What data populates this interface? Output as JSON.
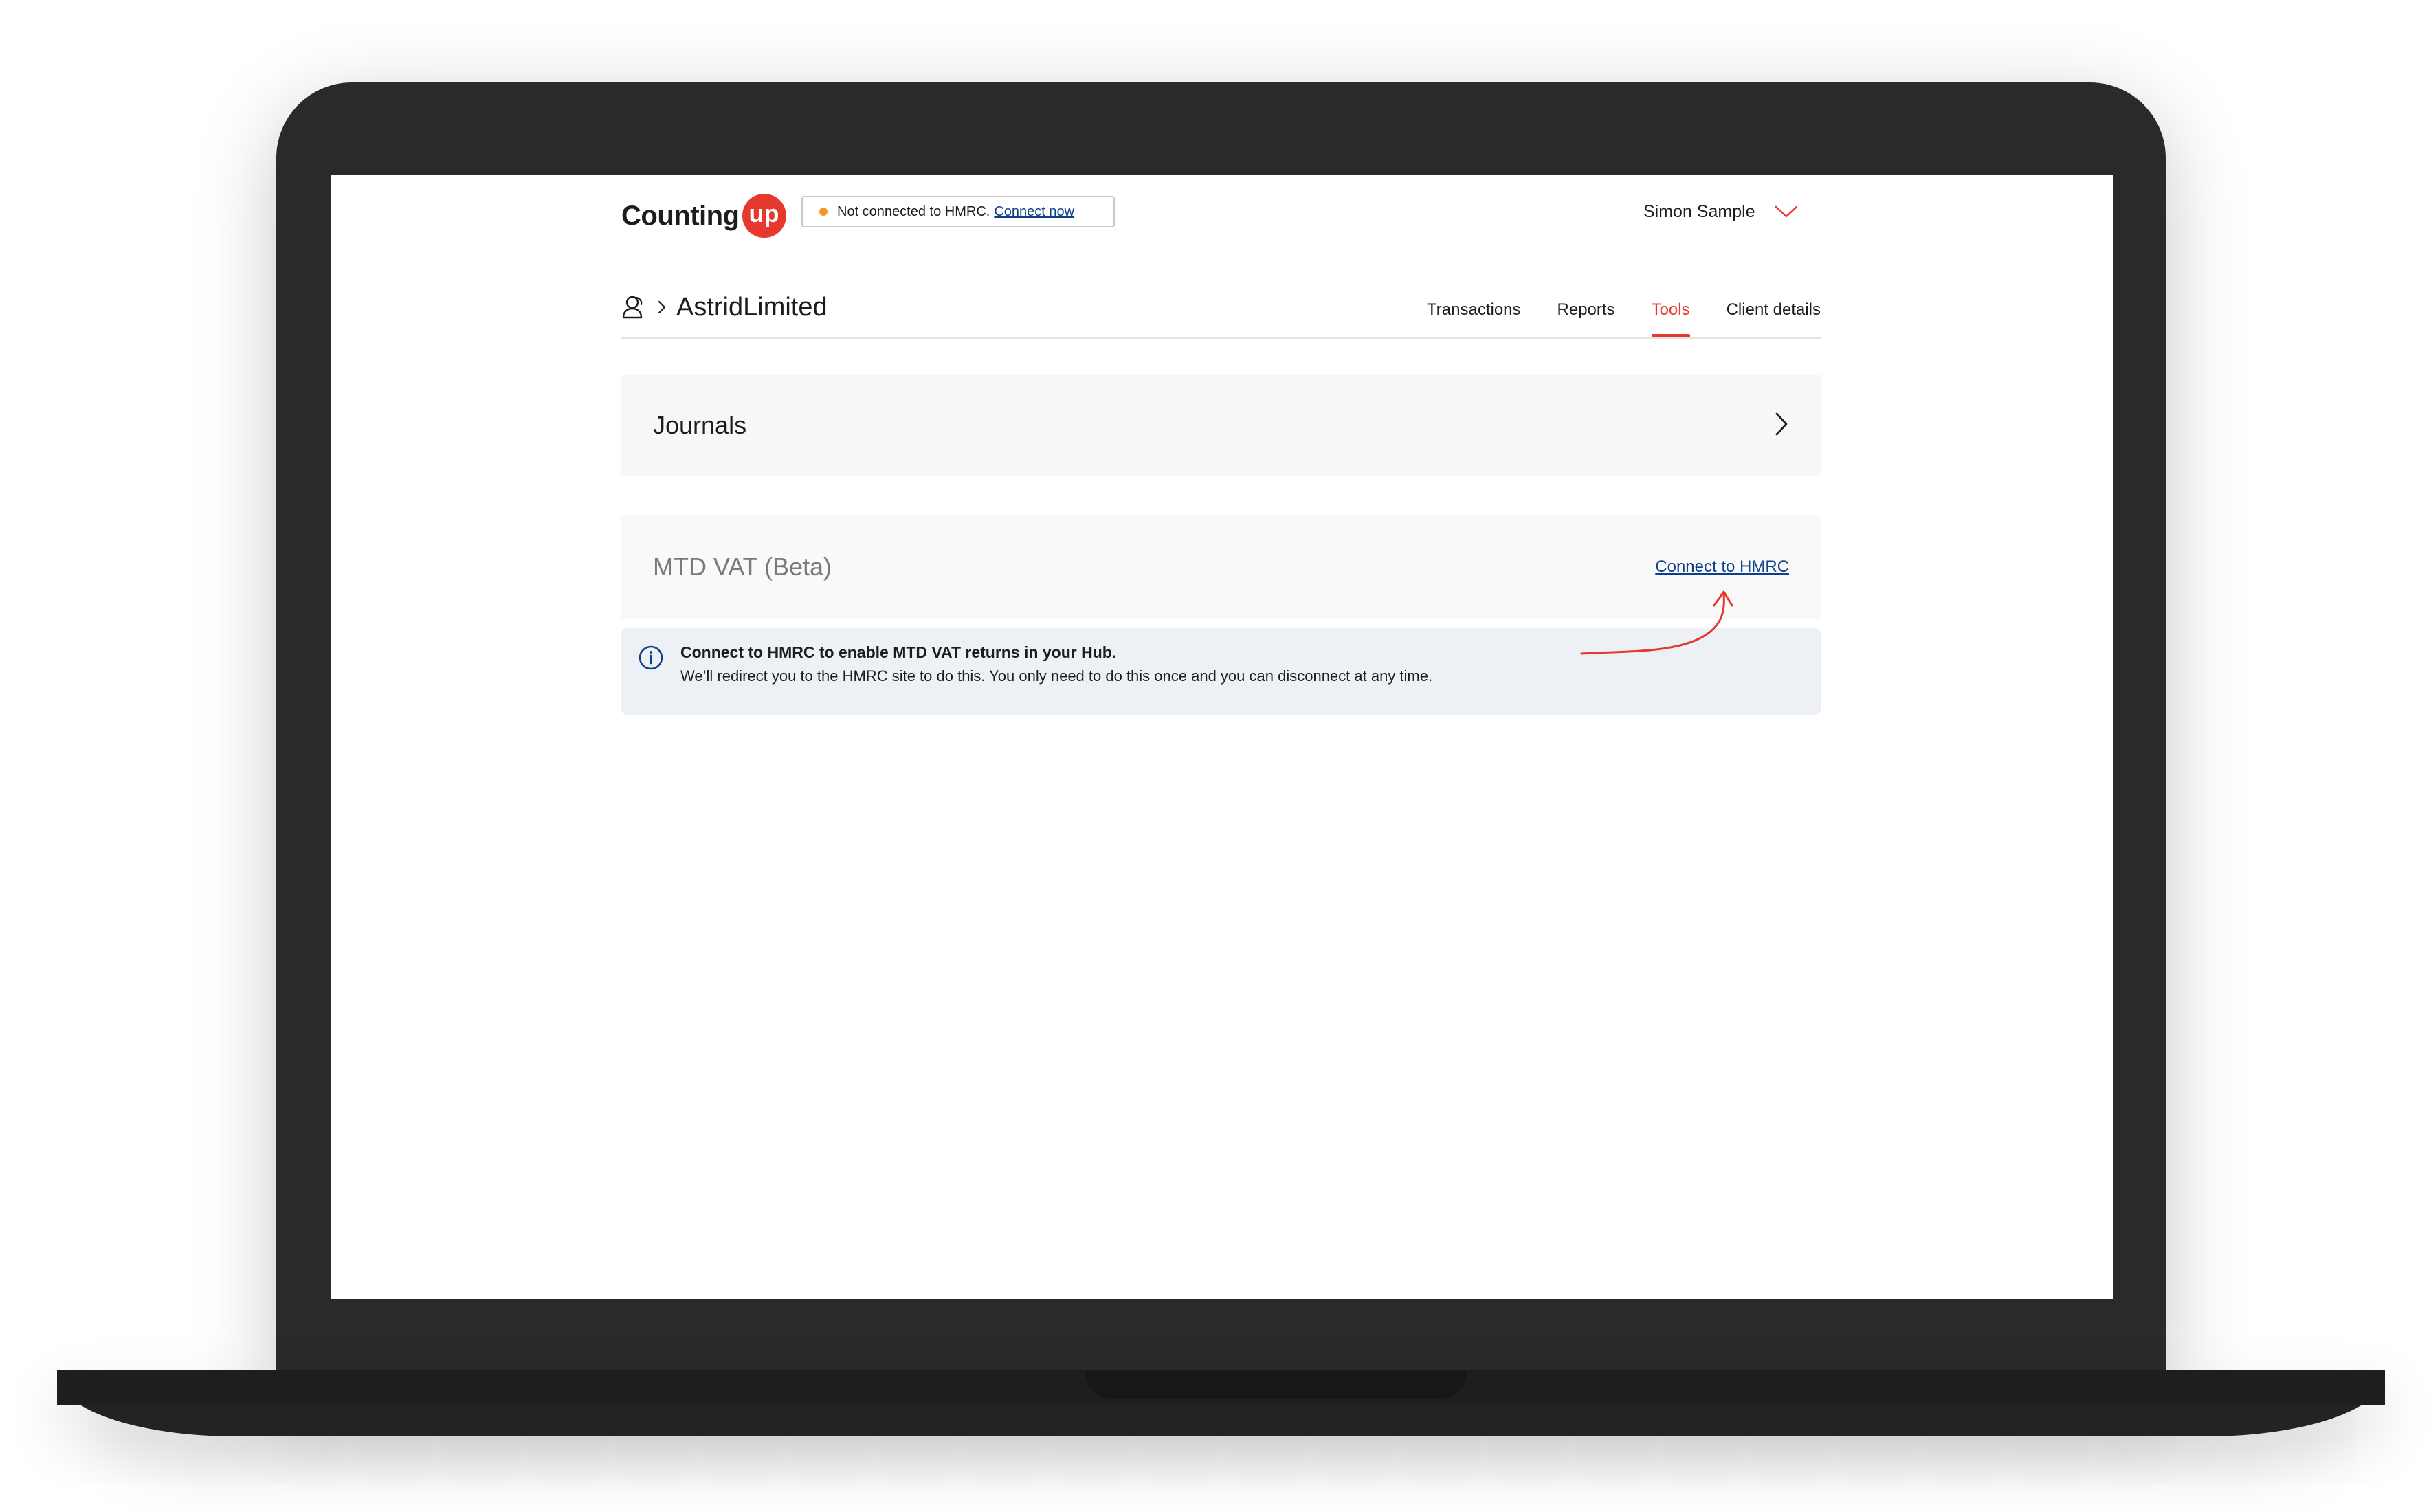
{
  "header": {
    "logo_text": "Counting",
    "logo_badge": "up",
    "hmrc_status": {
      "text": "Not connected to HMRC.",
      "link": "Connect now",
      "dot_color": "#f5962b"
    },
    "user": {
      "name": "Simon Sample"
    }
  },
  "breadcrumb": {
    "client_name": "AstridLimited"
  },
  "tabs": [
    {
      "label": "Transactions",
      "active": false
    },
    {
      "label": "Reports",
      "active": false
    },
    {
      "label": "Tools",
      "active": true
    },
    {
      "label": "Client details",
      "active": false
    }
  ],
  "cards": {
    "journals": {
      "title": "Journals"
    },
    "mtd_vat": {
      "title": "MTD VAT (Beta)",
      "link": "Connect to HMRC"
    }
  },
  "info": {
    "title": "Connect to HMRC to enable MTD VAT returns in your Hub.",
    "body": "We’ll redirect you to the HMRC site to do this. You only need to do this once and you can disconnect at any time."
  },
  "colors": {
    "accent": "#e6382f",
    "link": "#0d3f8a",
    "status_dot": "#f5962b",
    "info_bg": "#edf1f5"
  },
  "icons": [
    "client-icon",
    "breadcrumb-chevron-icon",
    "chevron-down-icon",
    "chevron-right-icon",
    "info-icon",
    "annotation-arrow-icon"
  ]
}
